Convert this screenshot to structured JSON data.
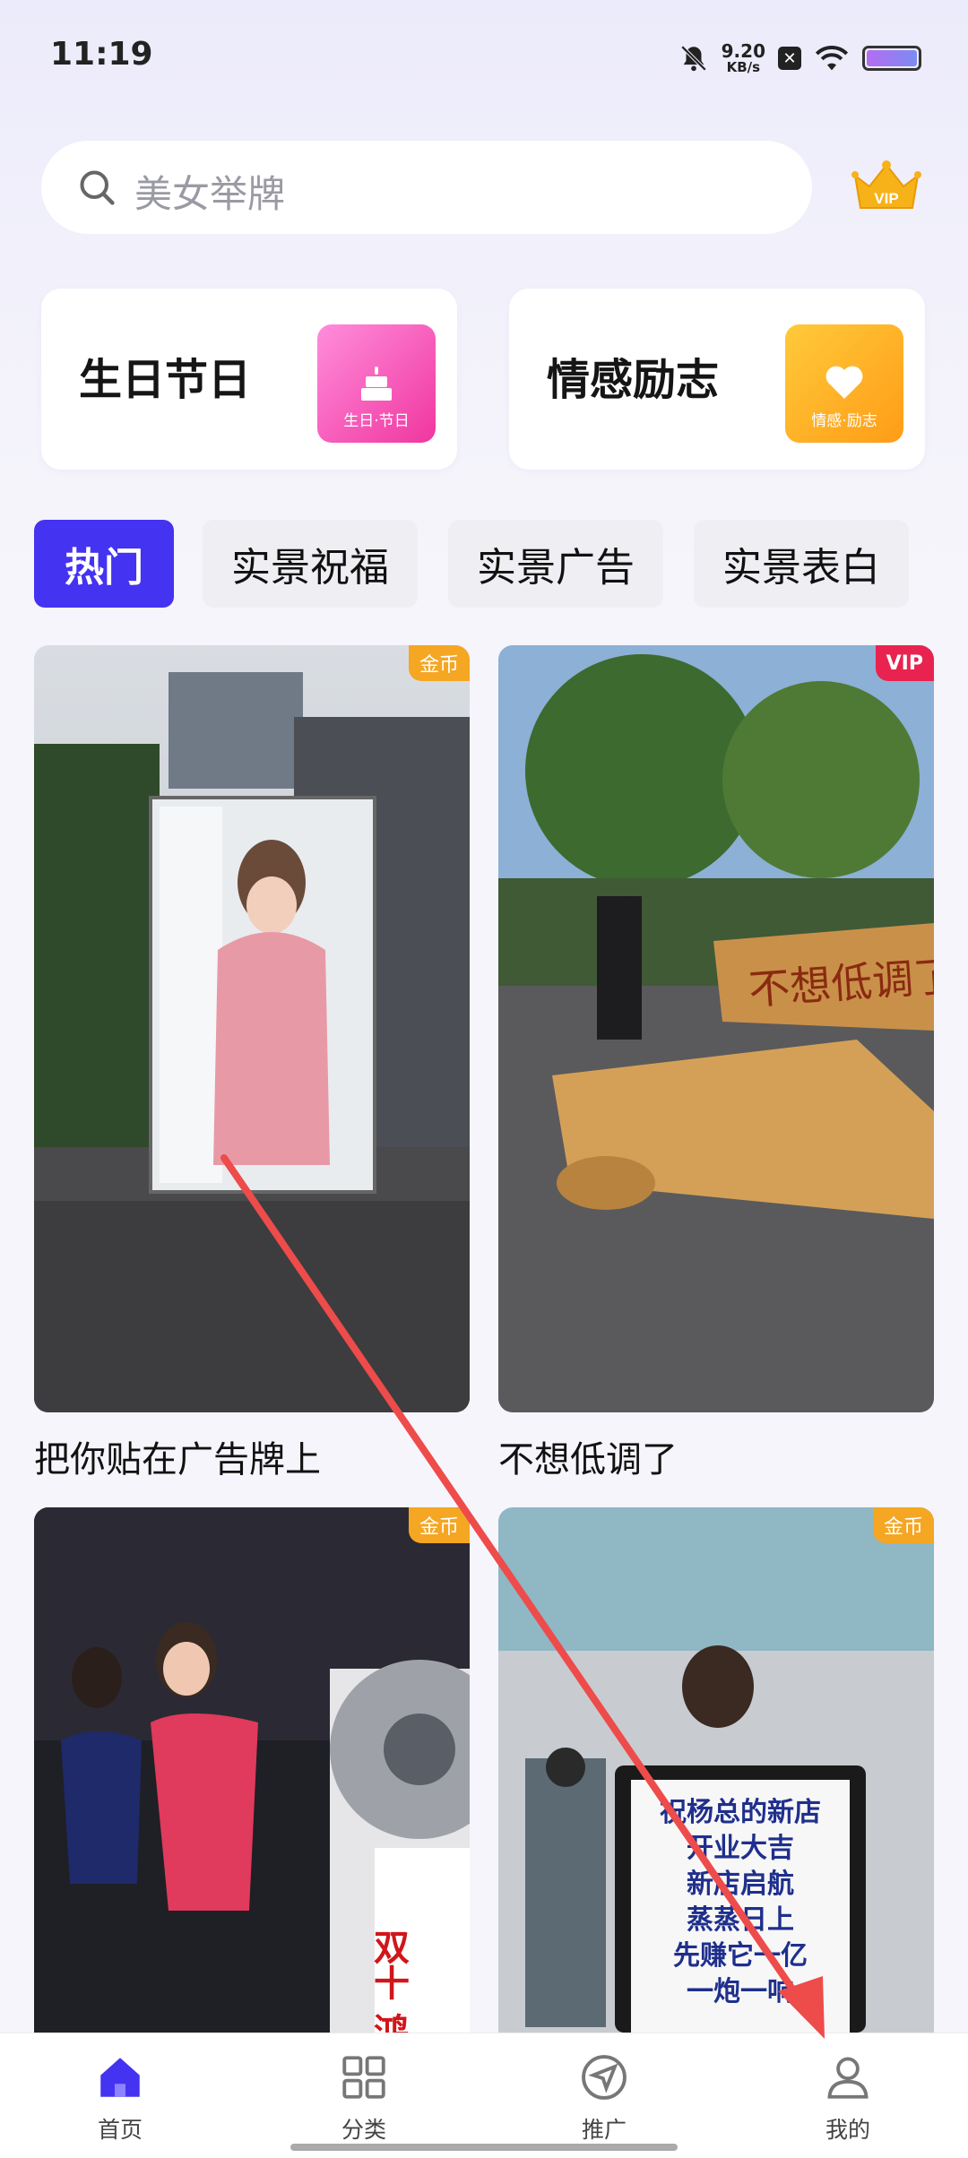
{
  "status_bar": {
    "time": "11:19",
    "speed_value": "9.20",
    "speed_unit": "KB/s"
  },
  "search": {
    "placeholder": "美女举牌"
  },
  "vip": {
    "label": "VIP"
  },
  "categories": [
    {
      "label": "生日节日",
      "badge_text": "生日·节日",
      "color_from": "#ff7fd8",
      "color_to": "#f0369f"
    },
    {
      "label": "情感励志",
      "badge_text": "情感·励志",
      "color_from": "#ffc233",
      "color_to": "#ff9f1a"
    }
  ],
  "tabs": [
    {
      "label": "热门",
      "active": true
    },
    {
      "label": "实景祝福",
      "active": false
    },
    {
      "label": "实景广告",
      "active": false
    },
    {
      "label": "实景表白",
      "active": false
    }
  ],
  "cards": [
    {
      "title": "把你贴在广告牌上",
      "badge": "金币",
      "image_text": ""
    },
    {
      "title": "不想低调了",
      "badge": "VIP",
      "image_text": "不想低调了"
    },
    {
      "title": "",
      "badge": "金币",
      "image_text": "双十 鸿运"
    },
    {
      "title": "",
      "badge": "金币",
      "image_text": "祝杨总的新店\n开业大吉\n新店启航\n蒸蒸日上\n先赚它一亿\n一炮一响"
    }
  ],
  "bottom_nav": [
    {
      "label": "首页",
      "icon": "home-icon",
      "active": true
    },
    {
      "label": "分类",
      "icon": "grid-icon",
      "active": false
    },
    {
      "label": "推广",
      "icon": "send-icon",
      "active": false
    },
    {
      "label": "我的",
      "icon": "person-icon",
      "active": false
    }
  ],
  "colors": {
    "accent": "#4433f0",
    "gold_badge": "#f5a623",
    "vip_badge": "#e8234f",
    "annotation_arrow": "#ee4b4b"
  }
}
